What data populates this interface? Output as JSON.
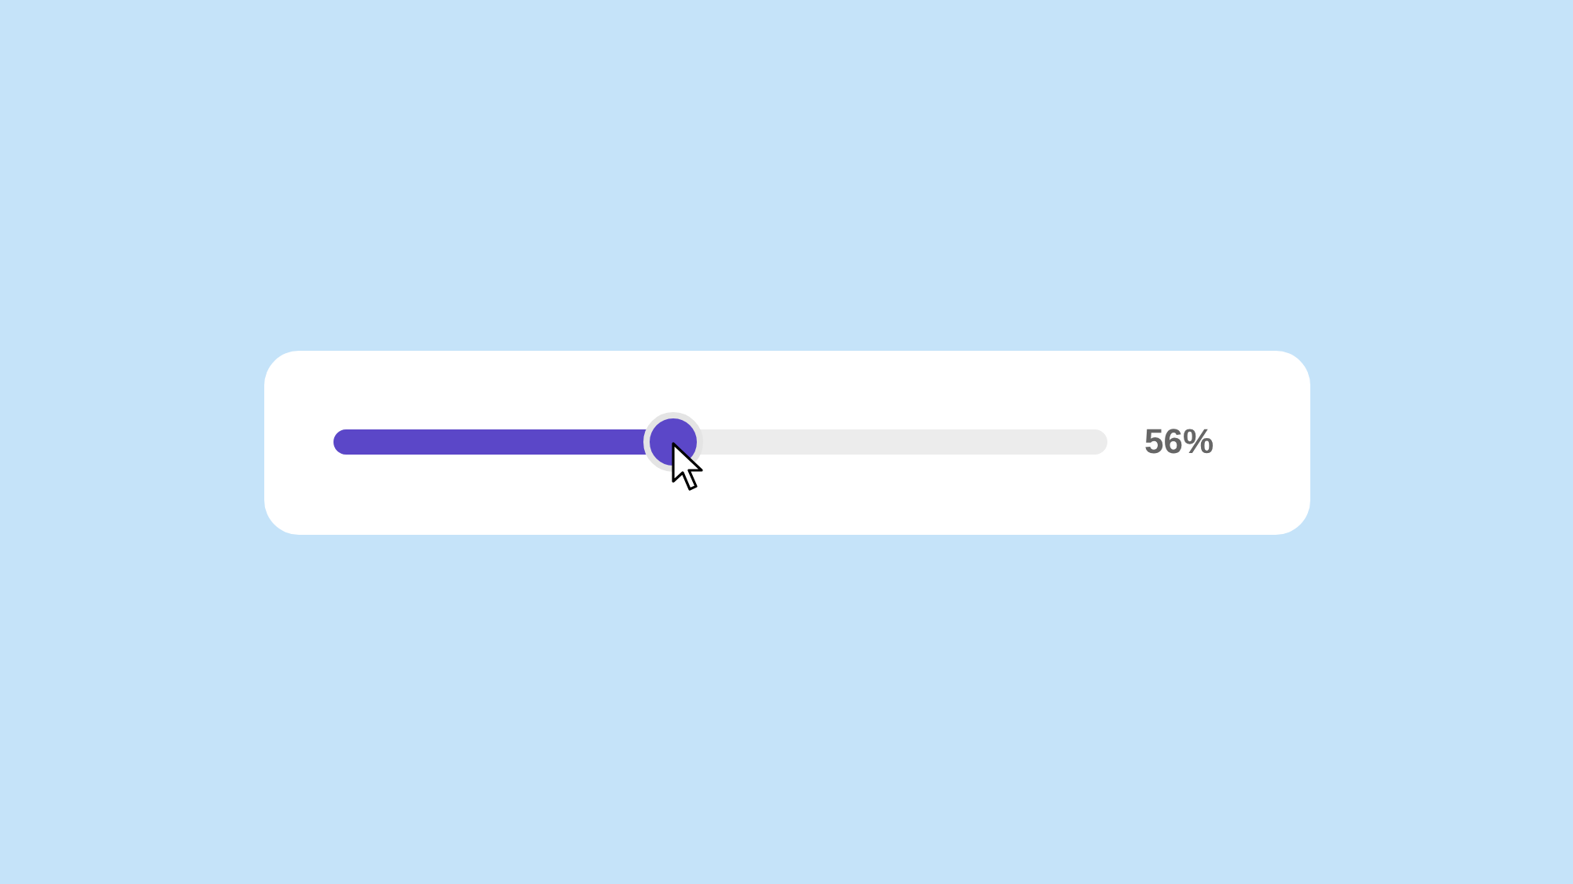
{
  "slider": {
    "level": 0.44,
    "reading": "56%"
  }
}
